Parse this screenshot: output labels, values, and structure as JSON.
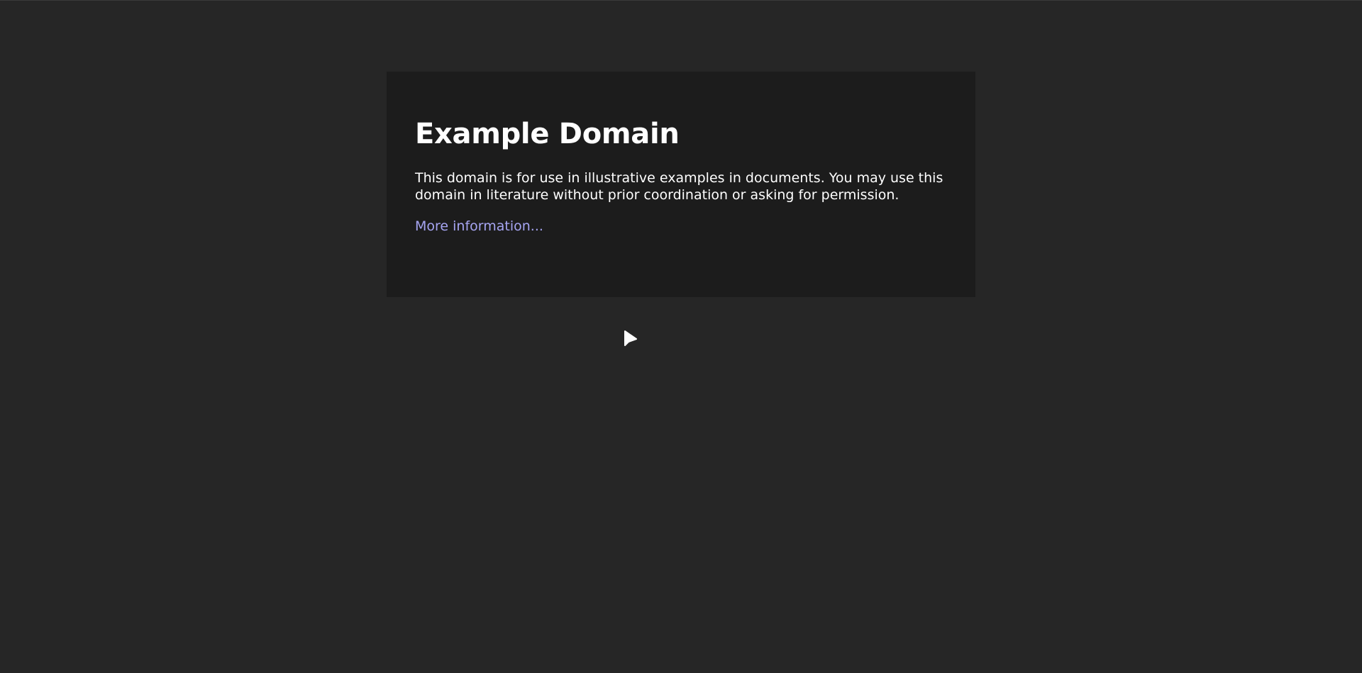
{
  "page": {
    "background_color": "#262626",
    "card_color": "#1c1c1c",
    "link_color": "#a6a5f2"
  },
  "content": {
    "heading": "Example Domain",
    "body": "This domain is for use in illustrative examples in documents. You may use this domain in literature without prior coordination or asking for permission.",
    "link_label": "More information..."
  },
  "cursor": {
    "icon": "mouse-pointer-icon"
  }
}
